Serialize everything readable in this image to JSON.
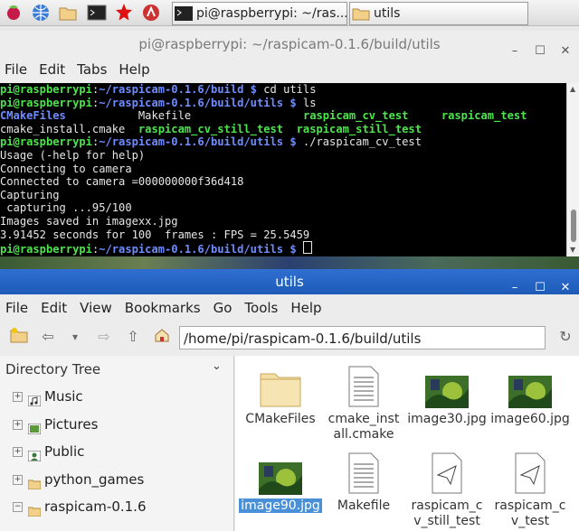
{
  "taskbar": {
    "tasks": [
      {
        "label": "pi@raspberrypi: ~/ras..."
      },
      {
        "label": "utils"
      }
    ]
  },
  "terminal": {
    "title": "pi@raspberrypi: ~/raspicam-0.1.6/build/utils",
    "menu": [
      "File",
      "Edit",
      "Tabs",
      "Help"
    ],
    "lines": [
      [
        {
          "t": "pi@raspberrypi",
          "c": "g"
        },
        {
          "t": ":",
          "c": "w"
        },
        {
          "t": "~/raspicam-0.1.6/build $",
          "c": "b"
        },
        {
          "t": " cd utils",
          "c": "w"
        }
      ],
      [
        {
          "t": "pi@raspberrypi",
          "c": "g"
        },
        {
          "t": ":",
          "c": "w"
        },
        {
          "t": "~/raspicam-0.1.6/build/utils $",
          "c": "b"
        },
        {
          "t": " ls",
          "c": "w"
        }
      ],
      [
        {
          "t": "CMakeFiles",
          "c": "b"
        },
        {
          "t": "           Makefile                 ",
          "c": "w"
        },
        {
          "t": "raspicam_cv_test",
          "c": "g"
        },
        {
          "t": "     ",
          "c": "w"
        },
        {
          "t": "raspicam_test",
          "c": "g"
        }
      ],
      [
        {
          "t": "cmake_install.cmake  ",
          "c": "w"
        },
        {
          "t": "raspicam_cv_still_test",
          "c": "g"
        },
        {
          "t": "  ",
          "c": "w"
        },
        {
          "t": "raspicam_still_test",
          "c": "g"
        }
      ],
      [
        {
          "t": "pi@raspberrypi",
          "c": "g"
        },
        {
          "t": ":",
          "c": "w"
        },
        {
          "t": "~/raspicam-0.1.6/build/utils $",
          "c": "b"
        },
        {
          "t": " ./raspicam_cv_test",
          "c": "w"
        }
      ],
      [
        {
          "t": "Usage (-help for help)",
          "c": "w"
        }
      ],
      [
        {
          "t": "Connecting to camera",
          "c": "w"
        }
      ],
      [
        {
          "t": "Connected to camera =000000000f36d418",
          "c": "w"
        }
      ],
      [
        {
          "t": "Capturing",
          "c": "w"
        }
      ],
      [
        {
          "t": " capturing ...95/100",
          "c": "w"
        }
      ],
      [
        {
          "t": "Images saved in imagexx.jpg",
          "c": "w"
        }
      ],
      [
        {
          "t": "3.91452 seconds for 100  frames : FPS = 25.5459",
          "c": "w"
        }
      ],
      [
        {
          "t": "pi@raspberrypi",
          "c": "g"
        },
        {
          "t": ":",
          "c": "w"
        },
        {
          "t": "~/raspicam-0.1.6/build/utils $",
          "c": "b"
        },
        {
          "t": " ",
          "c": "w"
        }
      ]
    ]
  },
  "filemanager": {
    "title": "utils",
    "menu": [
      "File",
      "Edit",
      "View",
      "Bookmarks",
      "Go",
      "Tools",
      "Help"
    ],
    "path": "/home/pi/raspicam-0.1.6/build/utils",
    "tree_header": "Directory Tree",
    "tree": [
      {
        "label": "Music"
      },
      {
        "label": "Pictures"
      },
      {
        "label": "Public"
      },
      {
        "label": "python_games"
      },
      {
        "label": "raspicam-0.1.6"
      }
    ],
    "files": [
      {
        "line1": "CMakeFiles",
        "line2": "",
        "kind": "folder"
      },
      {
        "line1": "cmake_inst",
        "line2": "all.cmake",
        "kind": "text"
      },
      {
        "line1": "image30.jpg",
        "line2": "",
        "kind": "image"
      },
      {
        "line1": "image60.jpg",
        "line2": "",
        "kind": "image"
      },
      {
        "line1": "image90.jpg",
        "line2": "",
        "kind": "image-selected"
      },
      {
        "line1": "Makefile",
        "line2": "",
        "kind": "text"
      },
      {
        "line1": "raspicam_c",
        "line2": "v_still_test",
        "kind": "exec"
      },
      {
        "line1": "raspicam_c",
        "line2": "v_test",
        "kind": "exec"
      }
    ]
  }
}
